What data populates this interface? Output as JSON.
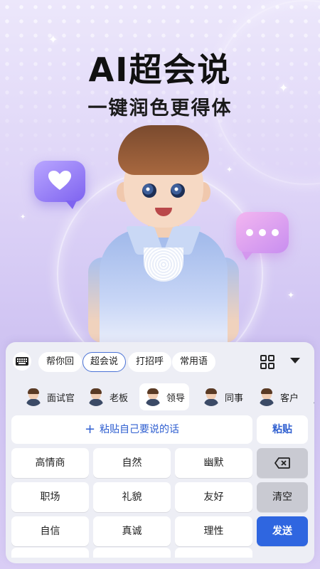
{
  "hero": {
    "title": "AI超会说",
    "subtitle": "一键润色更得体",
    "icons": [
      "heart-bubble-icon",
      "dots-bubble-icon"
    ]
  },
  "toolbar": {
    "keyboard_icon": "keyboard-icon",
    "chips": [
      "帮你回",
      "超会说",
      "打招呼",
      "常用语"
    ],
    "active_chip": "超会说",
    "grid_icon": "grid-icon",
    "collapse_icon": "triangle-down-icon"
  },
  "roles": [
    {
      "label": "面试官"
    },
    {
      "label": "老板"
    },
    {
      "label": "领导",
      "active": true
    },
    {
      "label": "同事"
    },
    {
      "label": "客户"
    }
  ],
  "input": {
    "paste_hint": "粘贴自己要说的话",
    "paste_button": "粘贴"
  },
  "keys": {
    "row1": [
      "高情商",
      "自然",
      "幽默"
    ],
    "row2": [
      "职场",
      "礼貌",
      "友好"
    ],
    "row3": [
      "自信",
      "真诚",
      "理性"
    ],
    "clear": "清空",
    "send": "发送",
    "backspace_icon": "backspace-icon"
  },
  "colors": {
    "accent": "#2f66e0",
    "panel_bg": "#edeef5",
    "hero_bg": "#ddd3f7"
  }
}
